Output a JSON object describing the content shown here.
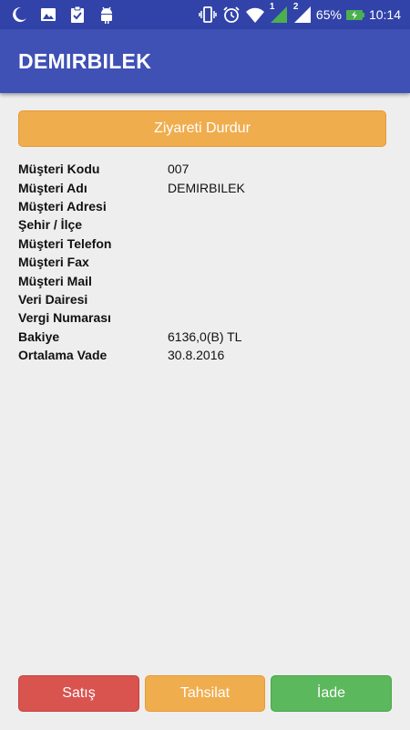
{
  "status_bar": {
    "left_icons": [
      "moon-icon",
      "image-icon",
      "clipboard-check-icon",
      "android-icon"
    ],
    "right_icons": [
      "vibrate-icon",
      "alarm-icon",
      "wifi-icon",
      "signal-sim1-icon",
      "signal-sim2-icon",
      "battery-charging-icon"
    ],
    "sim1_label": "1",
    "sim2_label": "2",
    "battery_percent": "65%",
    "time": "10:14"
  },
  "app_bar": {
    "title": "DEMIRBILEK"
  },
  "visit_button": {
    "label": "Ziyareti Durdur"
  },
  "customer_info": [
    {
      "label": "Müşteri Kodu",
      "value": "007"
    },
    {
      "label": "Müşteri Adı",
      "value": "DEMIRBILEK"
    },
    {
      "label": "Müşteri Adresi",
      "value": ""
    },
    {
      "label": "Şehir / İlçe",
      "value": ""
    },
    {
      "label": "Müşteri Telefon",
      "value": ""
    },
    {
      "label": "Müşteri Fax",
      "value": ""
    },
    {
      "label": "Müşteri Mail",
      "value": ""
    },
    {
      "label": "Veri Dairesi",
      "value": ""
    },
    {
      "label": "Vergi Numarası",
      "value": ""
    },
    {
      "label": "Bakiye",
      "value": "6136,0(B) TL"
    },
    {
      "label": "Ortalama Vade",
      "value": "30.8.2016"
    }
  ],
  "actions": {
    "satis": "Satış",
    "tahsilat": "Tahsilat",
    "iade": "İade"
  },
  "colors": {
    "status_bar": "#3143a8",
    "app_bar": "#3f51b5",
    "background": "#eeeeee",
    "warning": "#f0ad4e",
    "danger": "#d9534f",
    "success": "#5cb85c"
  }
}
